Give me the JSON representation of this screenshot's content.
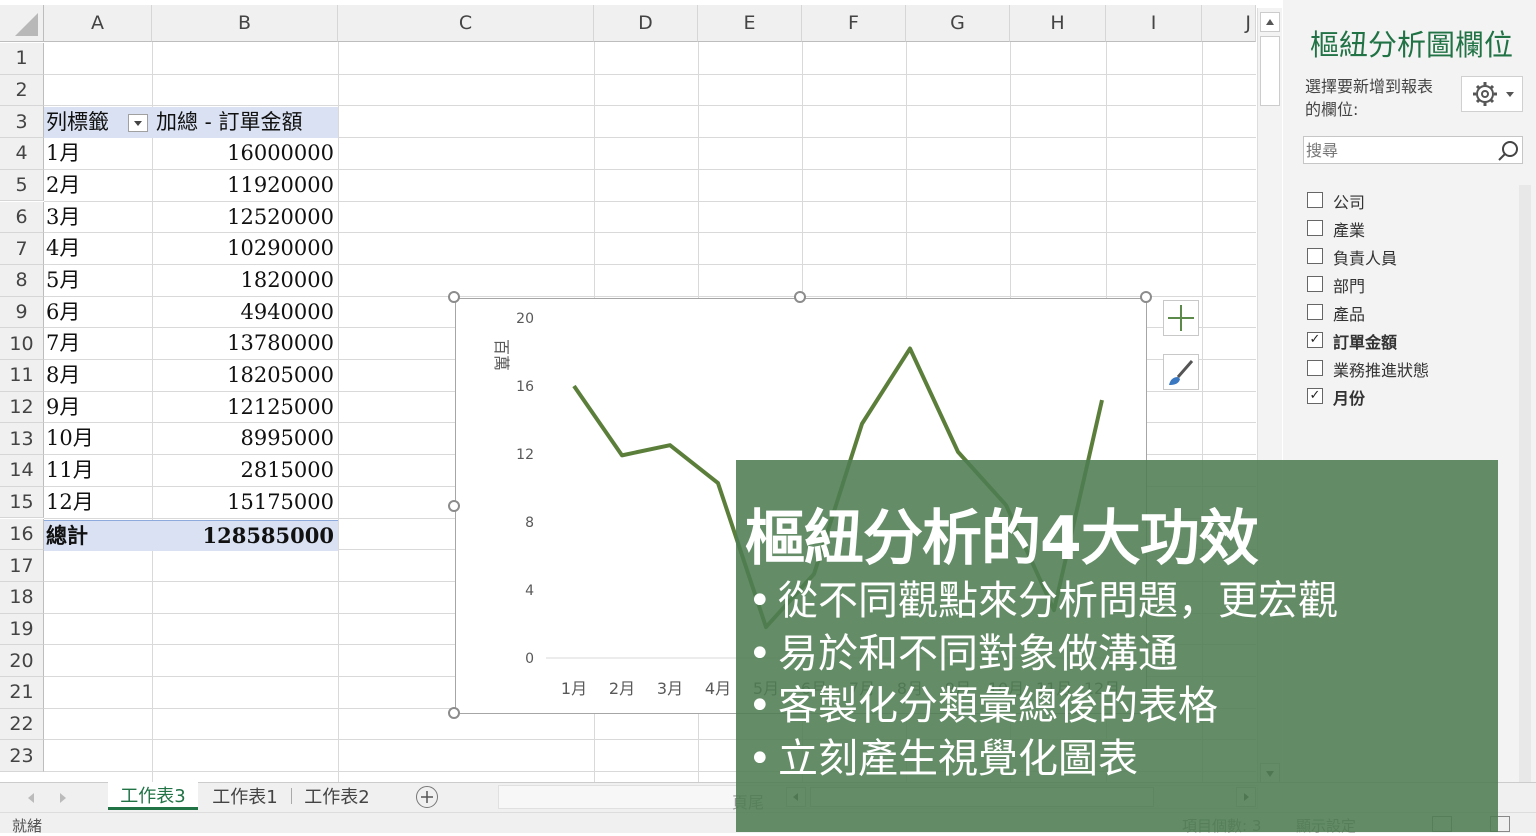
{
  "columns": [
    "A",
    "B",
    "C",
    "D",
    "E",
    "F",
    "G",
    "H",
    "I",
    "J"
  ],
  "rows": [
    "1",
    "2",
    "3",
    "4",
    "5",
    "6",
    "7",
    "8",
    "9",
    "10",
    "11",
    "12",
    "13",
    "14",
    "15",
    "16",
    "17",
    "18",
    "19",
    "20",
    "21",
    "22",
    "23"
  ],
  "pivot": {
    "header_a": "列標籤",
    "header_b": "加總 - 訂單金額",
    "months": [
      "1月",
      "2月",
      "3月",
      "4月",
      "5月",
      "6月",
      "7月",
      "8月",
      "9月",
      "10月",
      "11月",
      "12月"
    ],
    "values": [
      "16000000",
      "11920000",
      "12520000",
      "10290000",
      "1820000",
      "4940000",
      "13780000",
      "18205000",
      "12125000",
      "8995000",
      "2815000",
      "15175000"
    ],
    "total_label": "總計",
    "total_value": "128585000"
  },
  "chart_data": {
    "type": "line",
    "categories": [
      "1月",
      "2月",
      "3月",
      "4月",
      "5月",
      "6月",
      "7月",
      "8月",
      "9月",
      "10月",
      "11月",
      "12月"
    ],
    "visible_categories": [
      "1月",
      "2月",
      "3月",
      "4月",
      "5月"
    ],
    "series": [
      {
        "values": [
          16.0,
          11.92,
          12.52,
          10.29,
          1.82,
          4.94,
          13.78,
          18.205,
          12.125,
          8.995,
          2.815,
          15.175
        ]
      }
    ],
    "ylabel": "百萬",
    "ylim": [
      0,
      20
    ],
    "yticks": [
      "0",
      "4",
      "8",
      "12",
      "16",
      "20"
    ],
    "line_color": "#5b7f3b",
    "grid": false
  },
  "pane": {
    "title": "樞紐分析圖欄位",
    "subtitle_line1": "選擇要新增到報表",
    "subtitle_line2": "的欄位:",
    "search_placeholder": "搜尋",
    "fields": [
      {
        "label": "公司",
        "checked": false
      },
      {
        "label": "產業",
        "checked": false
      },
      {
        "label": "負責人員",
        "checked": false
      },
      {
        "label": "部門",
        "checked": false
      },
      {
        "label": "產品",
        "checked": false
      },
      {
        "label": "訂單金額",
        "checked": true
      },
      {
        "label": "業務推進狀態",
        "checked": false
      },
      {
        "label": "月份",
        "checked": true
      }
    ]
  },
  "tabs": [
    "工作表3",
    "工作表1",
    "工作表2"
  ],
  "status": {
    "ready": "就緒",
    "items": "項目個數: 3",
    "display": "顯示設定",
    "page": "頁尾"
  },
  "overlay": {
    "title": "樞紐分析的4大功效",
    "bullets": [
      "從不同觀點來分析問題，更宏觀",
      "易於和不同對象做溝通",
      "客製化分類彙總後的表格",
      "立刻產生視覺化圖表"
    ]
  },
  "colors": {
    "accent_green": "#4e7d52",
    "chart_line": "#5b7f3b",
    "header_band": "#d9e1f2"
  }
}
